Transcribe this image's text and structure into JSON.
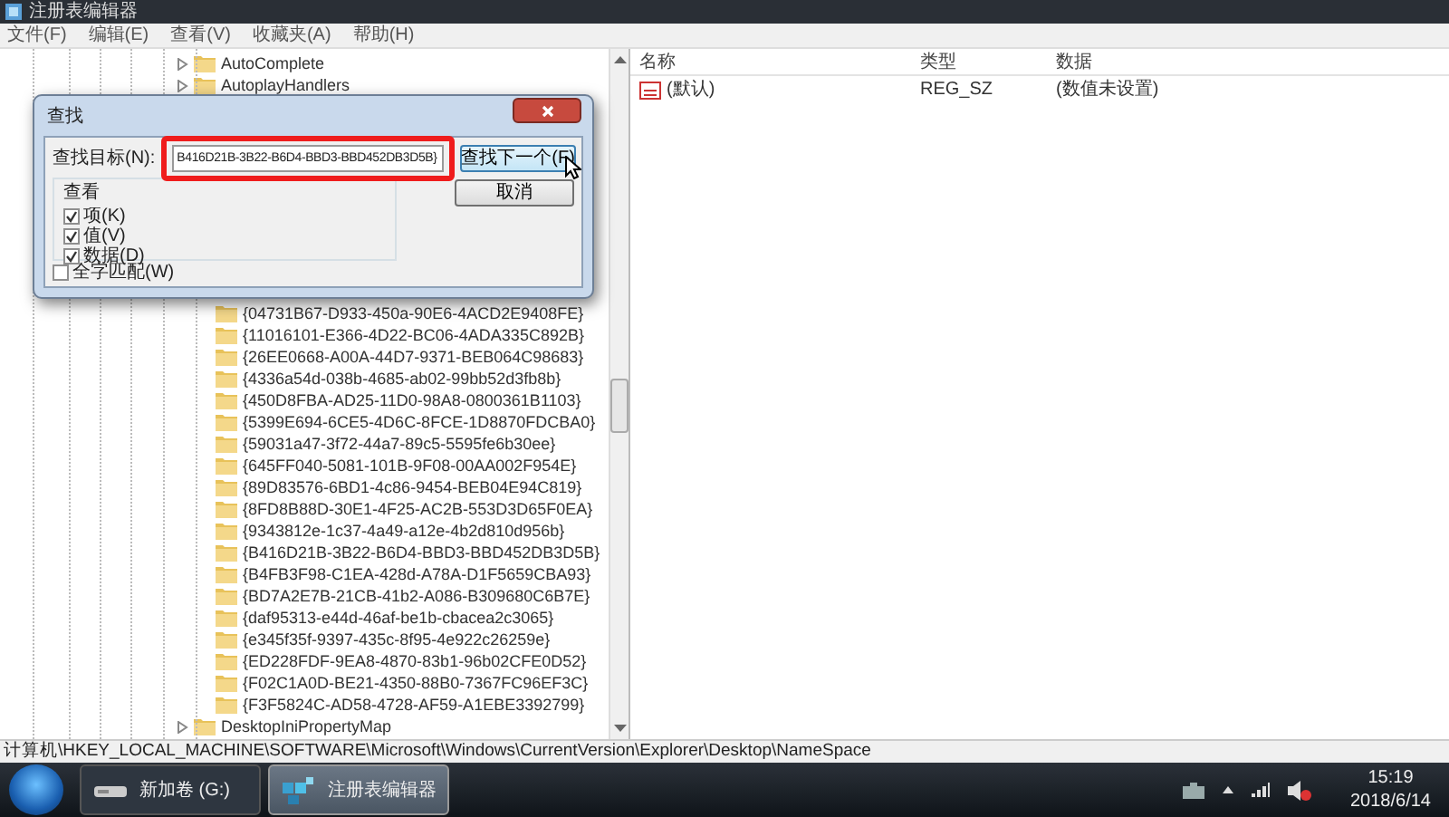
{
  "window": {
    "title": "注册表编辑器"
  },
  "menu": [
    "文件(F)",
    "编辑(E)",
    "查看(V)",
    "收藏夹(A)",
    "帮助(H)"
  ],
  "tree": {
    "items": [
      {
        "label": "AutoComplete",
        "expanded": false
      },
      {
        "label": "AutoplayHandlers",
        "expanded": false
      },
      {
        "children": [
          {
            "label": "{04731B67-D933-450a-90E6-4ACD2E9408FE}",
            "selected": false
          },
          {
            "label": "{11016101-E366-4D22-BC06-4ADA335C892B}",
            "selected": false
          },
          {
            "label": "{26EE0668-A00A-44D7-9371-BEB064C98683}",
            "selected": false
          },
          {
            "label": "{4336a54d-038b-4685-ab02-99bb52d3fb8b}",
            "selected": false
          },
          {
            "label": "{450D8FBA-AD25-11D0-98A8-0800361B1103}",
            "selected": false
          },
          {
            "label": "{5399E694-6CE5-4D6C-8FCE-1D8870FDCBA0}",
            "selected": false
          },
          {
            "label": "{59031a47-3f72-44a7-89c5-5595fe6b30ee}",
            "selected": false
          },
          {
            "label": "{645FF040-5081-101B-9F08-00AA002F954E}",
            "selected": false
          },
          {
            "label": "{89D83576-6BD1-4c86-9454-BEB04E94C819}",
            "selected": false
          },
          {
            "label": "{8FD8B88D-30E1-4F25-AC2B-553D3D65F0EA}",
            "selected": false
          },
          {
            "label": "{9343812e-1c37-4a49-a12e-4b2d810d956b}",
            "selected": false
          },
          {
            "label": "{B416D21B-3B22-B6D4-BBD3-BBD452DB3D5B}",
            "selected": false
          },
          {
            "label": "{B4FB3F98-C1EA-428d-A78A-D1F5659CBA93}",
            "selected": false
          },
          {
            "label": "{BD7A2E7B-21CB-41b2-A086-B309680C6B7E}",
            "selected": false
          },
          {
            "label": "{daf95313-e44d-46af-be1b-cbacea2c3065}",
            "selected": false
          },
          {
            "label": "{e345f35f-9397-435c-8f95-4e922c26259e}",
            "selected": false
          },
          {
            "label": "{ED228FDF-9EA8-4870-83b1-96b02CFE0D52}",
            "selected": false
          },
          {
            "label": "{F02C1A0D-BE21-4350-88B0-7367FC96EF3C}",
            "selected": false
          },
          {
            "label": "{F3F5824C-AD58-4728-AF59-A1EBE3392799}",
            "selected": false
          }
        ]
      },
      {
        "label": "DesktopIniPropertyMap",
        "expanded": false
      }
    ]
  },
  "values_table": {
    "columns": [
      "名称",
      "类型",
      "数据"
    ],
    "rows": [
      {
        "name": "(默认)",
        "type": "REG_SZ",
        "data": "(数值未设置)"
      }
    ]
  },
  "find_dialog": {
    "title": "查找",
    "target_label": "查找目标(N):",
    "target_value": "B416D21B-3B22-B6D4-BBD3-BBD452DB3D5B}",
    "find_next": "查找下一个(F)",
    "cancel": "取消",
    "group_title": "查看",
    "options": [
      {
        "label": "项(K)",
        "checked": true
      },
      {
        "label": "值(V)",
        "checked": true
      },
      {
        "label": "数据(D)",
        "checked": true
      }
    ],
    "whole_match": {
      "label": "全字匹配(W)",
      "checked": false
    }
  },
  "status_bar": "计算机\\HKEY_LOCAL_MACHINE\\SOFTWARE\\Microsoft\\Windows\\CurrentVersion\\Explorer\\Desktop\\NameSpace",
  "taskbar": {
    "buttons": [
      {
        "label": "新加卷 (G:)",
        "selected": false,
        "kind": "drive"
      },
      {
        "label": "注册表编辑器",
        "selected": true,
        "kind": "regedit"
      }
    ],
    "time": "15:19",
    "date": "2018/6/14"
  }
}
